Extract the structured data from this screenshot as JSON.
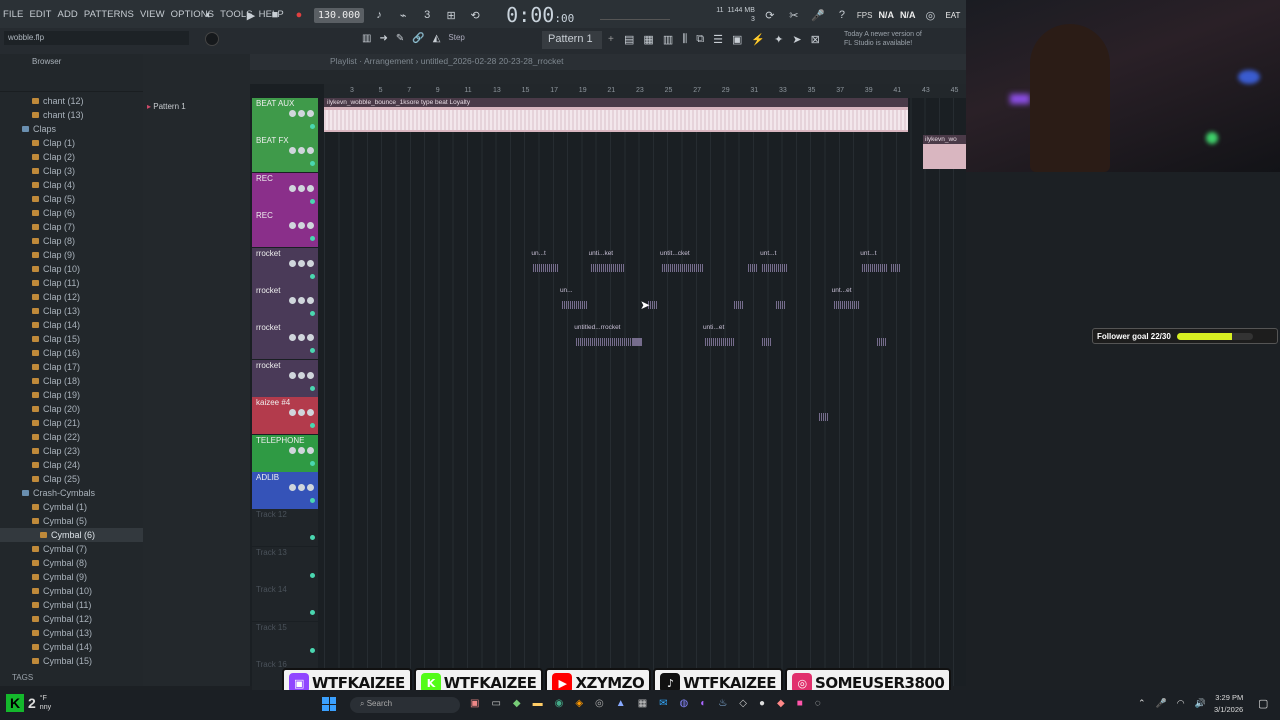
{
  "menu": {
    "items": [
      "FILE",
      "EDIT",
      "ADD",
      "PATTERNS",
      "VIEW",
      "OPTIONS",
      "TOOLS",
      "HELP"
    ]
  },
  "transport": {
    "tempo": "130.000",
    "time": "0:00",
    "time_sub": ":00",
    "cpu": "11",
    "memory": "1144 MB",
    "voices": "3"
  },
  "toolbar": {
    "filename": "wobble.flp",
    "step_label": "Step",
    "pattern_selector": "Pattern 1",
    "notice_line1": "Today   A newer version of",
    "notice_line2": "FL Studio is available!",
    "fps_label": "FPS",
    "na1": "N/A",
    "na2": "N/A",
    "beat_label": "EAT"
  },
  "browser": {
    "title": "Browser",
    "items": [
      {
        "label": "chant (12)",
        "type": "file"
      },
      {
        "label": "chant (13)",
        "type": "file"
      },
      {
        "label": "Claps",
        "type": "folder"
      },
      {
        "label": "Clap (1)",
        "type": "file"
      },
      {
        "label": "Clap (2)",
        "type": "file"
      },
      {
        "label": "Clap (3)",
        "type": "file"
      },
      {
        "label": "Clap (4)",
        "type": "file"
      },
      {
        "label": "Clap (5)",
        "type": "file"
      },
      {
        "label": "Clap (6)",
        "type": "file"
      },
      {
        "label": "Clap (7)",
        "type": "file"
      },
      {
        "label": "Clap (8)",
        "type": "file"
      },
      {
        "label": "Clap (9)",
        "type": "file"
      },
      {
        "label": "Clap (10)",
        "type": "file"
      },
      {
        "label": "Clap (11)",
        "type": "file"
      },
      {
        "label": "Clap (12)",
        "type": "file"
      },
      {
        "label": "Clap (13)",
        "type": "file"
      },
      {
        "label": "Clap (14)",
        "type": "file"
      },
      {
        "label": "Clap (15)",
        "type": "file"
      },
      {
        "label": "Clap (16)",
        "type": "file"
      },
      {
        "label": "Clap (17)",
        "type": "file"
      },
      {
        "label": "Clap (18)",
        "type": "file"
      },
      {
        "label": "Clap (19)",
        "type": "file"
      },
      {
        "label": "Clap (20)",
        "type": "file"
      },
      {
        "label": "Clap (21)",
        "type": "file"
      },
      {
        "label": "Clap (22)",
        "type": "file"
      },
      {
        "label": "Clap (23)",
        "type": "file"
      },
      {
        "label": "Clap (24)",
        "type": "file"
      },
      {
        "label": "Clap (25)",
        "type": "file"
      },
      {
        "label": "Crash-Cymbals",
        "type": "folder"
      },
      {
        "label": "Cymbal (1)",
        "type": "file"
      },
      {
        "label": "Cymbal (5)",
        "type": "file"
      },
      {
        "label": "Cymbal (6)",
        "type": "file",
        "selected": true
      },
      {
        "label": "Cymbal (7)",
        "type": "file"
      },
      {
        "label": "Cymbal (8)",
        "type": "file"
      },
      {
        "label": "Cymbal (9)",
        "type": "file"
      },
      {
        "label": "Cymbal (10)",
        "type": "file"
      },
      {
        "label": "Cymbal (11)",
        "type": "file"
      },
      {
        "label": "Cymbal (12)",
        "type": "file"
      },
      {
        "label": "Cymbal (13)",
        "type": "file"
      },
      {
        "label": "Cymbal (14)",
        "type": "file"
      },
      {
        "label": "Cymbal (15)",
        "type": "file"
      }
    ],
    "tags_label": "TAGS"
  },
  "patterns": {
    "items": [
      "Pattern 1"
    ]
  },
  "playlist": {
    "title": "Playlist · Arrangement",
    "project": "untitled_2026-02-28 20-23-28_rrocket",
    "ruler": [
      "3",
      "5",
      "7",
      "9",
      "11",
      "13",
      "15",
      "17",
      "19",
      "21",
      "23",
      "25",
      "27",
      "29",
      "31",
      "33",
      "35",
      "37",
      "39",
      "41",
      "43",
      "45"
    ],
    "tracks": [
      {
        "name": "BEAT AUX",
        "color": "#3f9a4a"
      },
      {
        "name": "BEAT FX",
        "color": "#3f9a4a"
      },
      {
        "name": "REC",
        "color": "#8a2f8a"
      },
      {
        "name": "REC",
        "color": "#8a2f8a"
      },
      {
        "name": "rrocket",
        "color": "#4a3a58"
      },
      {
        "name": "rrocket",
        "color": "#4a3a58"
      },
      {
        "name": "rrocket",
        "color": "#4a3a58"
      },
      {
        "name": "rrocket",
        "color": "#4a3a58"
      },
      {
        "name": "kaizee #4",
        "color": "#b33b4c"
      },
      {
        "name": "TELEPHONE",
        "color": "#2f9a44"
      },
      {
        "name": "ADLIB",
        "color": "#3553b8"
      },
      {
        "name": "Track 12",
        "color": ""
      },
      {
        "name": "Track 13",
        "color": ""
      },
      {
        "name": "Track 14",
        "color": ""
      },
      {
        "name": "Track 15",
        "color": ""
      },
      {
        "name": "Track 16",
        "color": ""
      }
    ],
    "main_clip": "ilykevn_wobble_bounce_1ksore type beat Loyalty",
    "side_clip": "ilykevn_wo",
    "clips": [
      {
        "label": "un...t",
        "row": 4,
        "bar": 15.5
      },
      {
        "label": "unti...ket",
        "row": 4,
        "bar": 19.5
      },
      {
        "label": "untit...cket",
        "row": 4,
        "bar": 24.5
      },
      {
        "label": "",
        "row": 4,
        "bar": 30.5
      },
      {
        "label": "unt...t",
        "row": 4,
        "bar": 31.5
      },
      {
        "label": "unt...t",
        "row": 4,
        "bar": 38.5
      },
      {
        "label": "",
        "row": 4,
        "bar": 40.5
      },
      {
        "label": "un...",
        "row": 5,
        "bar": 17.5
      },
      {
        "label": "",
        "row": 5,
        "bar": 23.5
      },
      {
        "label": "",
        "row": 5,
        "bar": 29.5
      },
      {
        "label": "",
        "row": 5,
        "bar": 32.5
      },
      {
        "label": "unt...et",
        "row": 5,
        "bar": 36.5
      },
      {
        "label": "untitled...rrocket",
        "row": 6,
        "bar": 18.5
      },
      {
        "label": "",
        "row": 6,
        "bar": 22.5
      },
      {
        "label": "unti...et",
        "row": 6,
        "bar": 27.5
      },
      {
        "label": "",
        "row": 6,
        "bar": 31.5
      },
      {
        "label": "",
        "row": 6,
        "bar": 39.5
      },
      {
        "label": "",
        "row": 8,
        "bar": 35.5
      }
    ]
  },
  "overlay": {
    "goal_label": "Follower goal 22/30",
    "goal_fraction": 0.73,
    "socials": [
      {
        "platform": "twitch",
        "handle": "WTFKAIZEE",
        "color": "#9146ff"
      },
      {
        "platform": "kick",
        "handle": "WTFKAIZEE",
        "color": "#53fc18"
      },
      {
        "platform": "youtube",
        "handle": "XZYMZO",
        "color": "#ff0000"
      },
      {
        "platform": "tiktok",
        "handle": "WTFKAIZEE",
        "color": "#111111"
      },
      {
        "platform": "instagram",
        "handle": "SOMEUSER3800",
        "color": "#e1306c"
      }
    ]
  },
  "taskbar": {
    "weather_temp": "2",
    "weather_unit": "°F",
    "weather_desc": "nny",
    "search_placeholder": "Search",
    "time": "3:29 PM",
    "date": "3/1/2026"
  }
}
